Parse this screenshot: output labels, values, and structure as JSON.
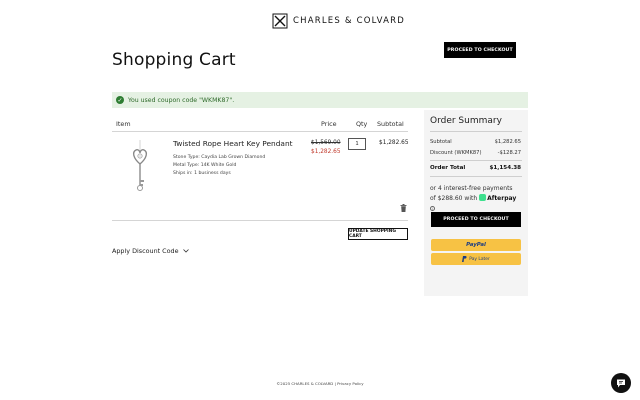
{
  "brand": {
    "name": "CHARLES & COLVARD"
  },
  "header": {
    "checkout_label": "PROCEED TO CHECKOUT"
  },
  "page": {
    "title": "Shopping Cart"
  },
  "notice": {
    "message": "You used coupon code \"WKMK87\".",
    "icon": "check-circle-icon",
    "color": "#2e7d32"
  },
  "cart": {
    "columns": {
      "item": "Item",
      "price": "Price",
      "qty": "Qty",
      "subtotal": "Subtotal"
    },
    "item": {
      "name": "Twisted Rope Heart Key Pendant",
      "options": [
        "Stone Type:  Caydia Lab Grown Diamond",
        "Metal Type:  14K White Gold",
        "Ships in:  1 business days"
      ],
      "price_original": "$1,569.00",
      "price_sale": "$1,282.65",
      "qty": "1",
      "subtotal": "$1,282.65"
    },
    "update_label": "UPDATE SHOPPING CART",
    "discount_label": "Apply Discount Code"
  },
  "summary": {
    "title": "Order Summary",
    "rows": [
      {
        "label": "Subtotal",
        "value": "$1,282.65"
      },
      {
        "label": "Discount (WKMK87)",
        "value": "-$128.27"
      }
    ],
    "total": {
      "label": "Order Total",
      "value": "$1,154.38"
    },
    "afterpay": {
      "line1": "or 4 interest-free payments",
      "line2_prefix": "of $288.60 with",
      "brand": "Afterpay"
    },
    "checkout_label": "PROCEED TO CHECKOUT",
    "paypal_label": "PayPal",
    "paylater_label": "Pay Later"
  },
  "footer": {
    "text": "©2025 CHARLES & COLVARD | Privacy Policy"
  },
  "colors": {
    "accent": "#000000",
    "sale": "#c0392b",
    "paypal": "#f7c244",
    "notice_bg": "#e5f1e3",
    "summary_bg": "#f4f4f4"
  }
}
